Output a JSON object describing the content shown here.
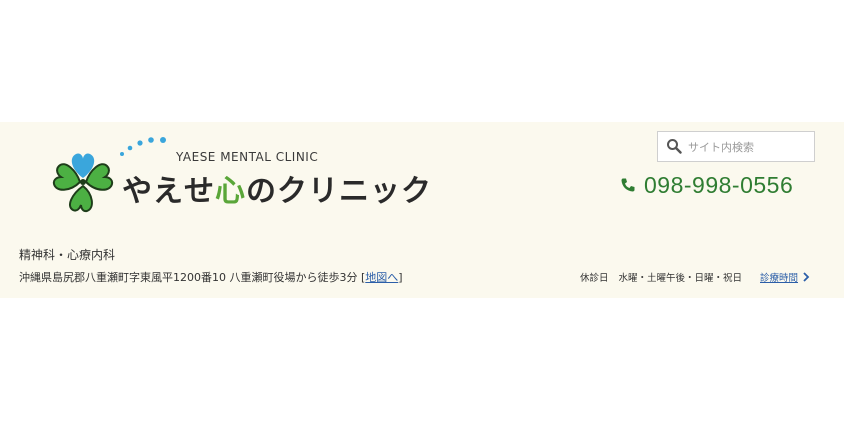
{
  "logo": {
    "subtitle": "YAESE MENTAL CLINIC",
    "name_part1": "やえせ",
    "name_kokoro": "心",
    "name_part2": "のクリニック"
  },
  "search": {
    "placeholder": "サイト内検索",
    "value": ""
  },
  "phone": {
    "number": "098-998-0556"
  },
  "departments": "精神科・心療内科",
  "address": {
    "text": "沖縄県島尻郡八重瀬町字東風平1200番10 八重瀬町役場から徒歩3分 [",
    "map_link": "地図へ",
    "close": "]"
  },
  "hours": {
    "closed_label": "休診日",
    "closed_days": "水曜・土曜午後・日曜・祝日",
    "link": "診療時間"
  },
  "colors": {
    "brand_green": "#2f7d32",
    "clover_blue": "#3aa6dc",
    "clover_green": "#4cb043",
    "link_blue": "#2b5ea8",
    "band_bg": "#fbf9ee"
  }
}
